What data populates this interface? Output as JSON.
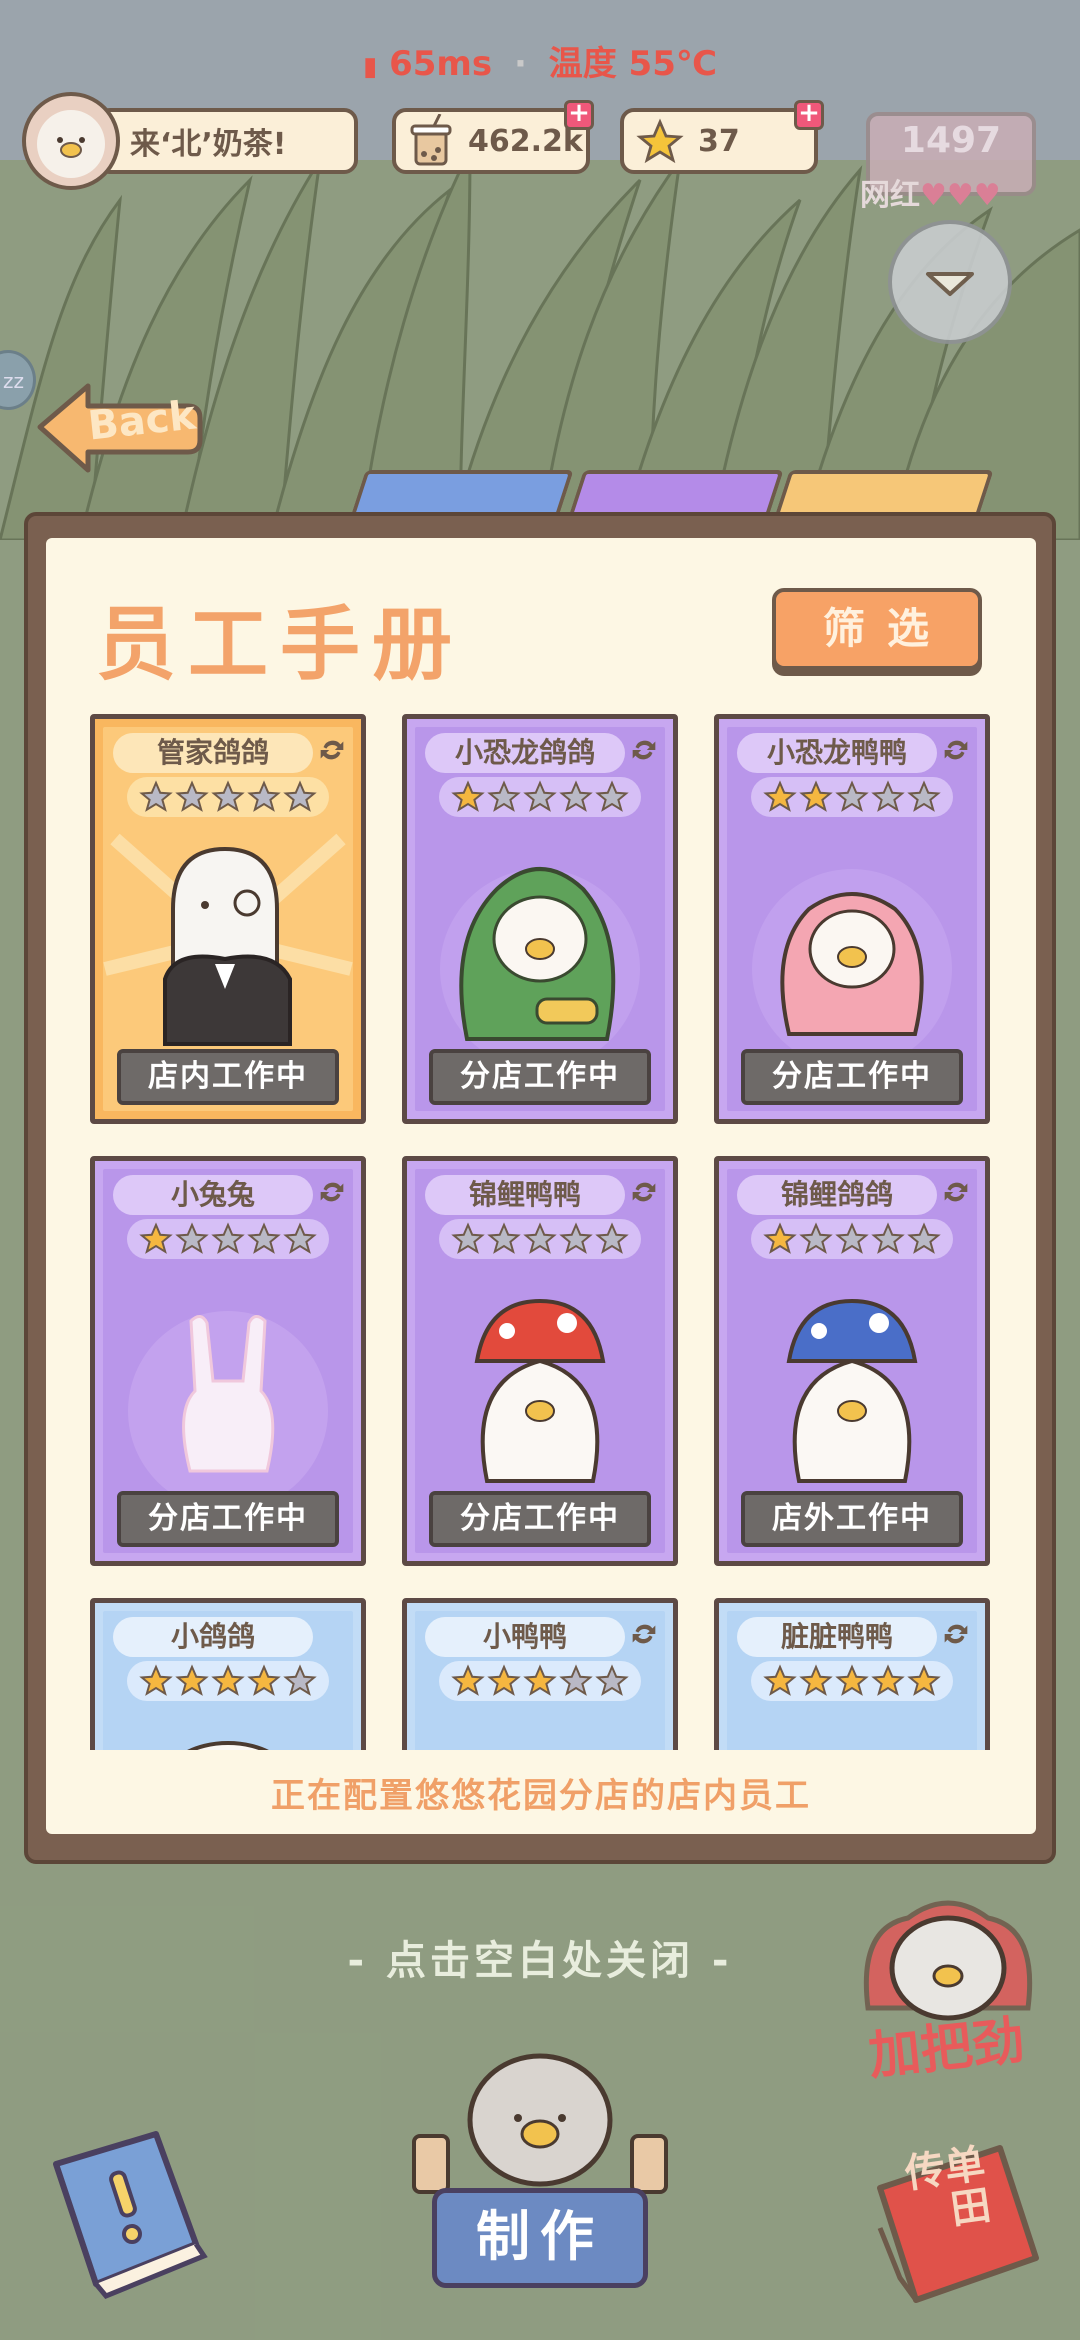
{
  "status": {
    "ping": "65ms",
    "separator": "·",
    "temperature": "温度 55℃"
  },
  "hud": {
    "shop_name": "来‘北’奶茶!",
    "milk_tea_count": "462.2k",
    "star_count": "37",
    "fame_value": "1497",
    "fame_label": "网红"
  },
  "back_label": "Back",
  "side_badge": "zz",
  "panel": {
    "title": "员工手册",
    "filter_label": "筛选",
    "note": "正在配置悠悠花园分店的店内员工",
    "tab_colors": [
      "#7a9ee0",
      "#b48be8",
      "#f6c778"
    ]
  },
  "employees": [
    {
      "name": "管家鸽鸽",
      "rarity": "gold",
      "stars": 0,
      "status": "店内工作中",
      "art": "butler-pigeon"
    },
    {
      "name": "小恐龙鸽鸽",
      "rarity": "purple",
      "stars": 1,
      "status": "分店工作中",
      "art": "dino-pigeon"
    },
    {
      "name": "小恐龙鸭鸭",
      "rarity": "purple",
      "stars": 2,
      "status": "分店工作中",
      "art": "dino-duck"
    },
    {
      "name": "小兔兔",
      "rarity": "purple",
      "stars": 1,
      "status": "分店工作中",
      "art": "bunny"
    },
    {
      "name": "锦鲤鸭鸭",
      "rarity": "purple",
      "stars": 0,
      "status": "分店工作中",
      "art": "koi-duck"
    },
    {
      "name": "锦鲤鸽鸽",
      "rarity": "purple",
      "stars": 1,
      "status": "店外工作中",
      "art": "koi-pigeon"
    },
    {
      "name": "小鸽鸽",
      "rarity": "blue",
      "stars": 4,
      "status": "",
      "art": "pigeon"
    },
    {
      "name": "小鸭鸭",
      "rarity": "blue",
      "stars": 3,
      "status": "",
      "art": "duck"
    },
    {
      "name": "脏脏鸭鸭",
      "rarity": "blue",
      "stars": 5,
      "status": "",
      "art": "dirty-duck"
    }
  ],
  "close_hint": "- 点击空白处关闭 -",
  "bottom": {
    "make_label": "制作",
    "cheer_label": "加把劲",
    "flyer_label": "传单",
    "flyer_sub": "田"
  },
  "colors": {
    "gold_card": "#f9b75f",
    "purple_card": "#c7a7f0",
    "blue_card": "#c2dcf6",
    "star_filled": "#f5b740",
    "star_empty": "#b9b9c6",
    "title": "#f3a36a"
  }
}
